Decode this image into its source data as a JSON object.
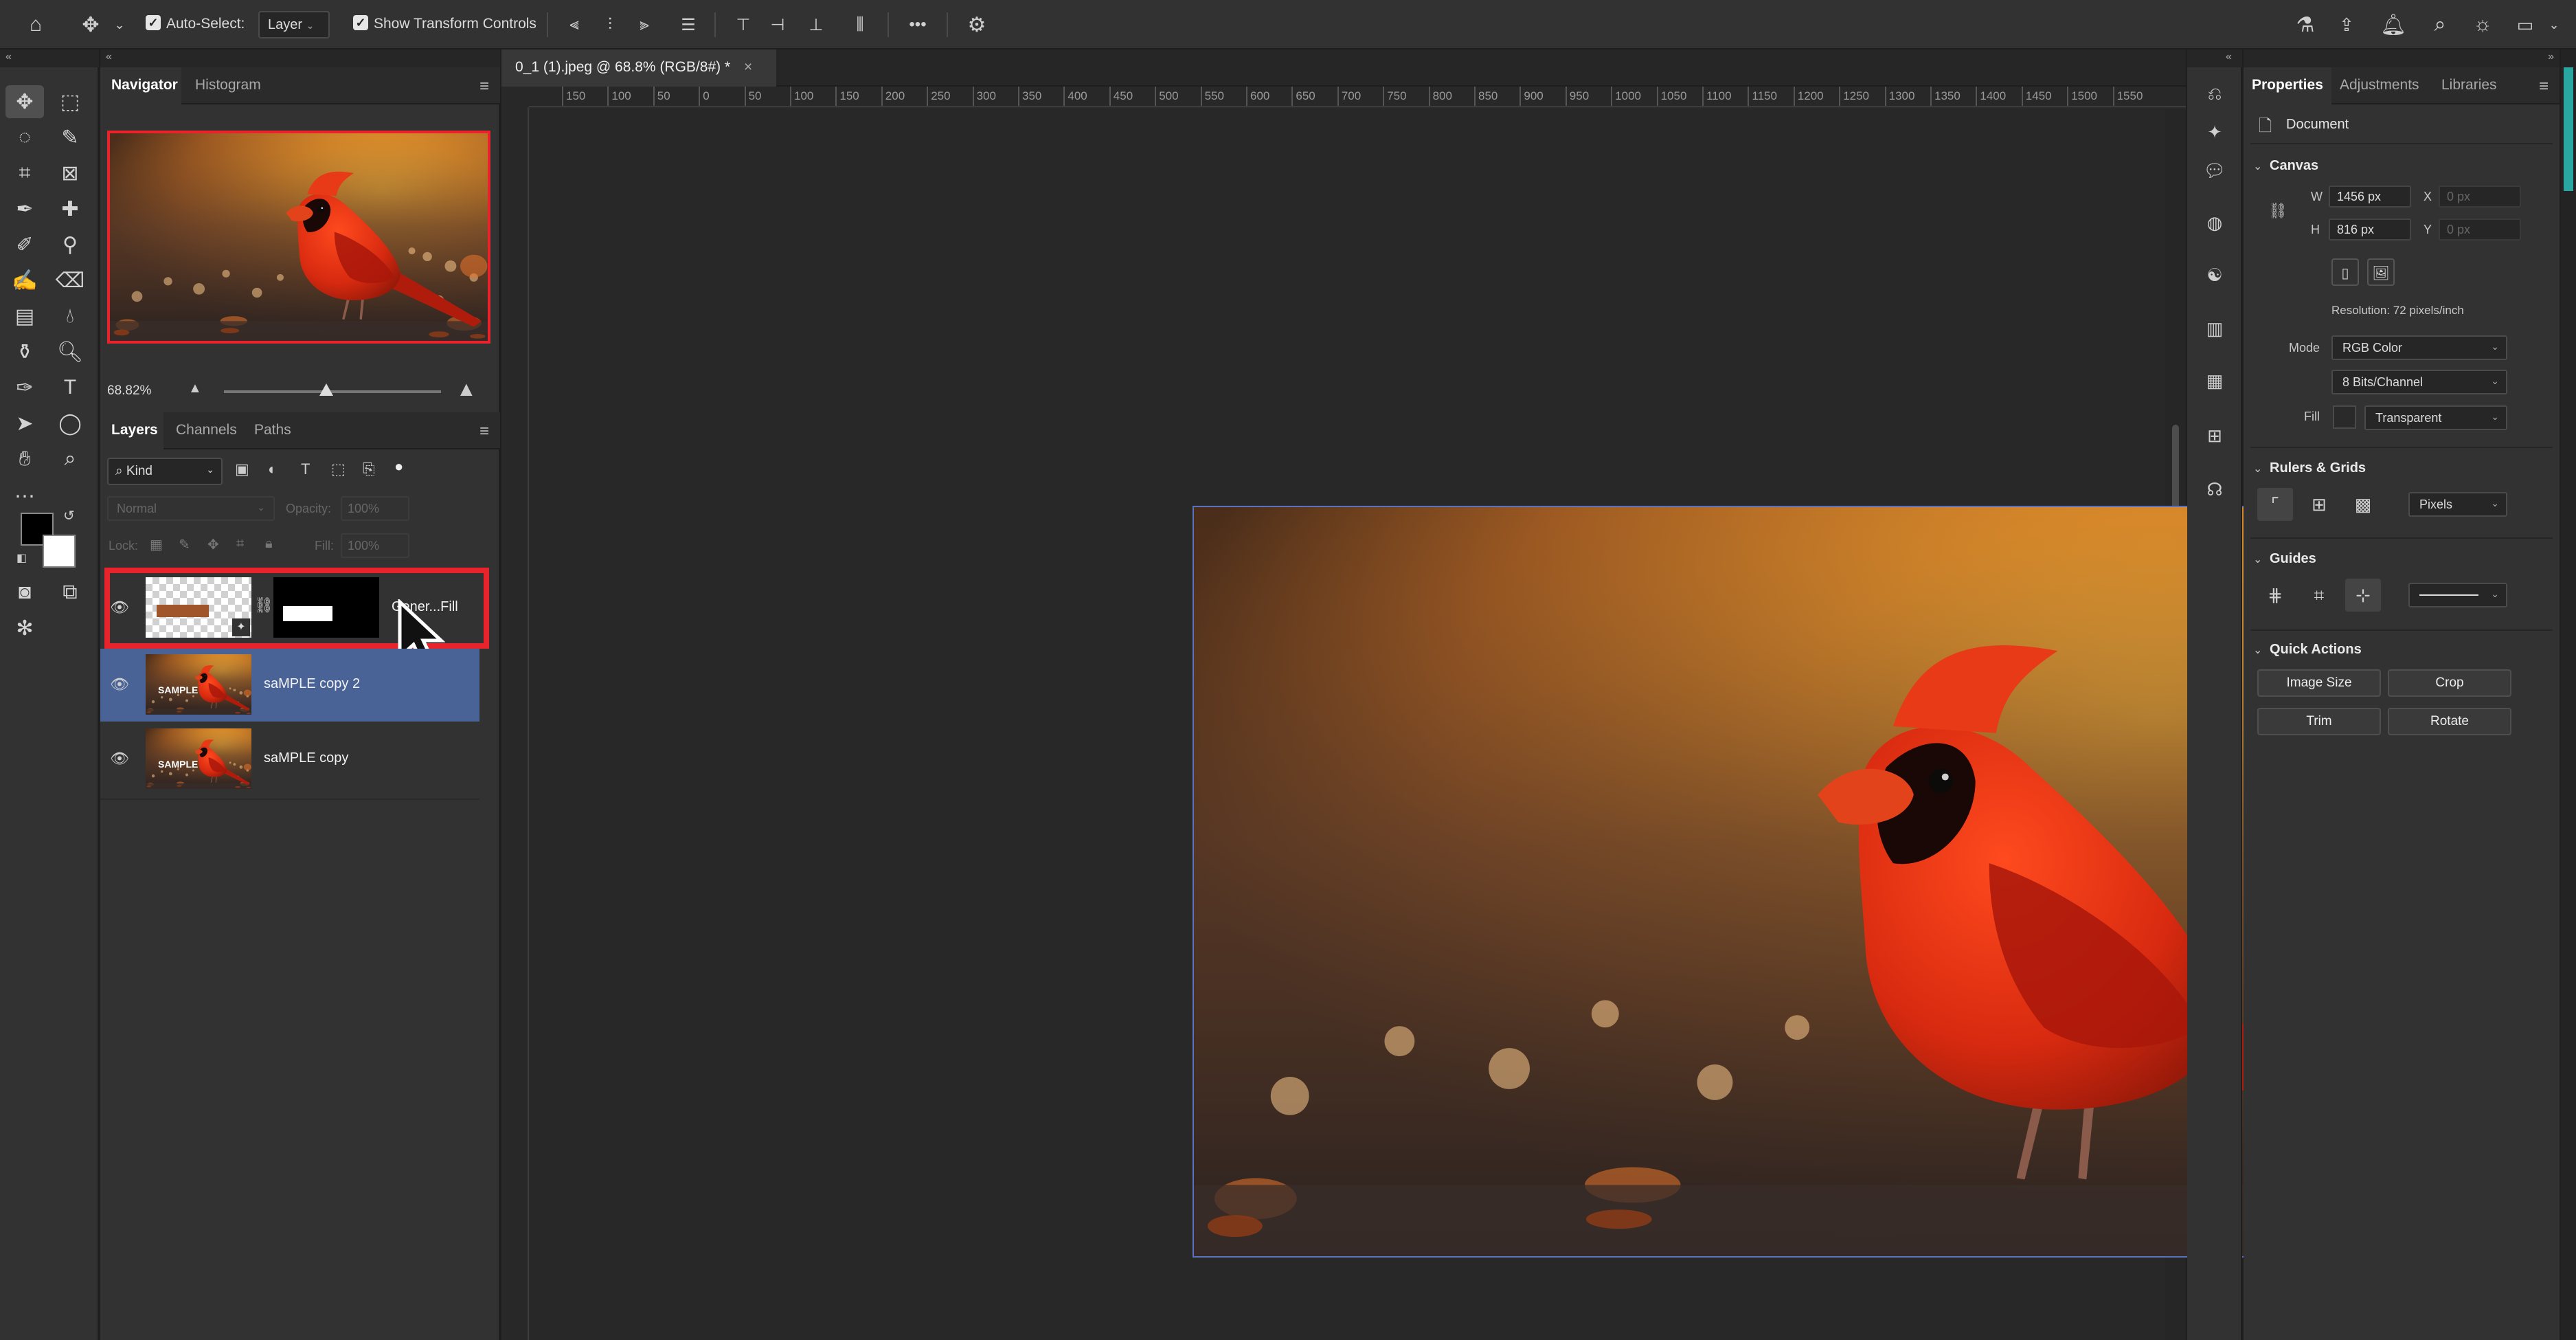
{
  "options_bar": {
    "auto_select_label": "Auto-Select:",
    "auto_select_value": "Layer",
    "show_transform_label": "Show Transform Controls",
    "more_label": "•••"
  },
  "left_panels": {
    "navigator_tab": "Navigator",
    "histogram_tab": "Histogram",
    "zoom_value": "68.82%",
    "zoom_slider_fraction": 0.47,
    "layers_tab": "Layers",
    "channels_tab": "Channels",
    "paths_tab": "Paths",
    "filter_kind": "Kind",
    "blend_mode": "Normal",
    "opacity_label": "Opacity:",
    "opacity_value": "100%",
    "lock_label": "Lock:",
    "fill_label": "Fill:",
    "fill_value": "100%",
    "layers": [
      {
        "name": "Gener...Fill",
        "selected": false,
        "highlighted": true
      },
      {
        "name": "saMPLE copy 2",
        "selected": true,
        "highlighted": false
      },
      {
        "name": "saMPLE copy",
        "selected": false,
        "highlighted": false
      }
    ],
    "thumb_text": "SAMPLE"
  },
  "document": {
    "tab_title": "0_1 (1).jpeg @ 68.8% (RGB/8#) *",
    "close_glyph": "×",
    "ruler_h_labels": [
      "150",
      "100",
      "50",
      "0",
      "50",
      "100",
      "150",
      "200",
      "250",
      "300",
      "350",
      "400",
      "450",
      "500",
      "550",
      "600",
      "650",
      "700",
      "750",
      "800",
      "850",
      "900",
      "950",
      "1000",
      "1050",
      "1100",
      "1150",
      "1200",
      "1250",
      "1300",
      "1350",
      "1400",
      "1450",
      "1500",
      "1550"
    ]
  },
  "properties": {
    "properties_tab": "Properties",
    "adjustments_tab": "Adjustments",
    "libraries_tab": "Libraries",
    "document_label": "Document",
    "canvas_section": "Canvas",
    "w_label": "W",
    "w_value": "1456 px",
    "h_label": "H",
    "h_value": "816 px",
    "x_label": "X",
    "x_value": "0 px",
    "y_label": "Y",
    "y_value": "0 px",
    "resolution": "Resolution: 72 pixels/inch",
    "mode_label": "Mode",
    "mode_value": "RGB Color",
    "bits_value": "8 Bits/Channel",
    "fill_label": "Fill",
    "fill_value": "Transparent",
    "rulers_section": "Rulers & Grids",
    "units_value": "Pixels",
    "guides_section": "Guides",
    "quick_actions_section": "Quick Actions",
    "image_size_btn": "Image Size",
    "crop_btn": "Crop",
    "trim_btn": "Trim",
    "rotate_btn": "Rotate"
  },
  "colors": {
    "accent_highlight": "#e8232b",
    "selected_layer": "#4a6396",
    "canvas_border": "#5a72c0"
  }
}
